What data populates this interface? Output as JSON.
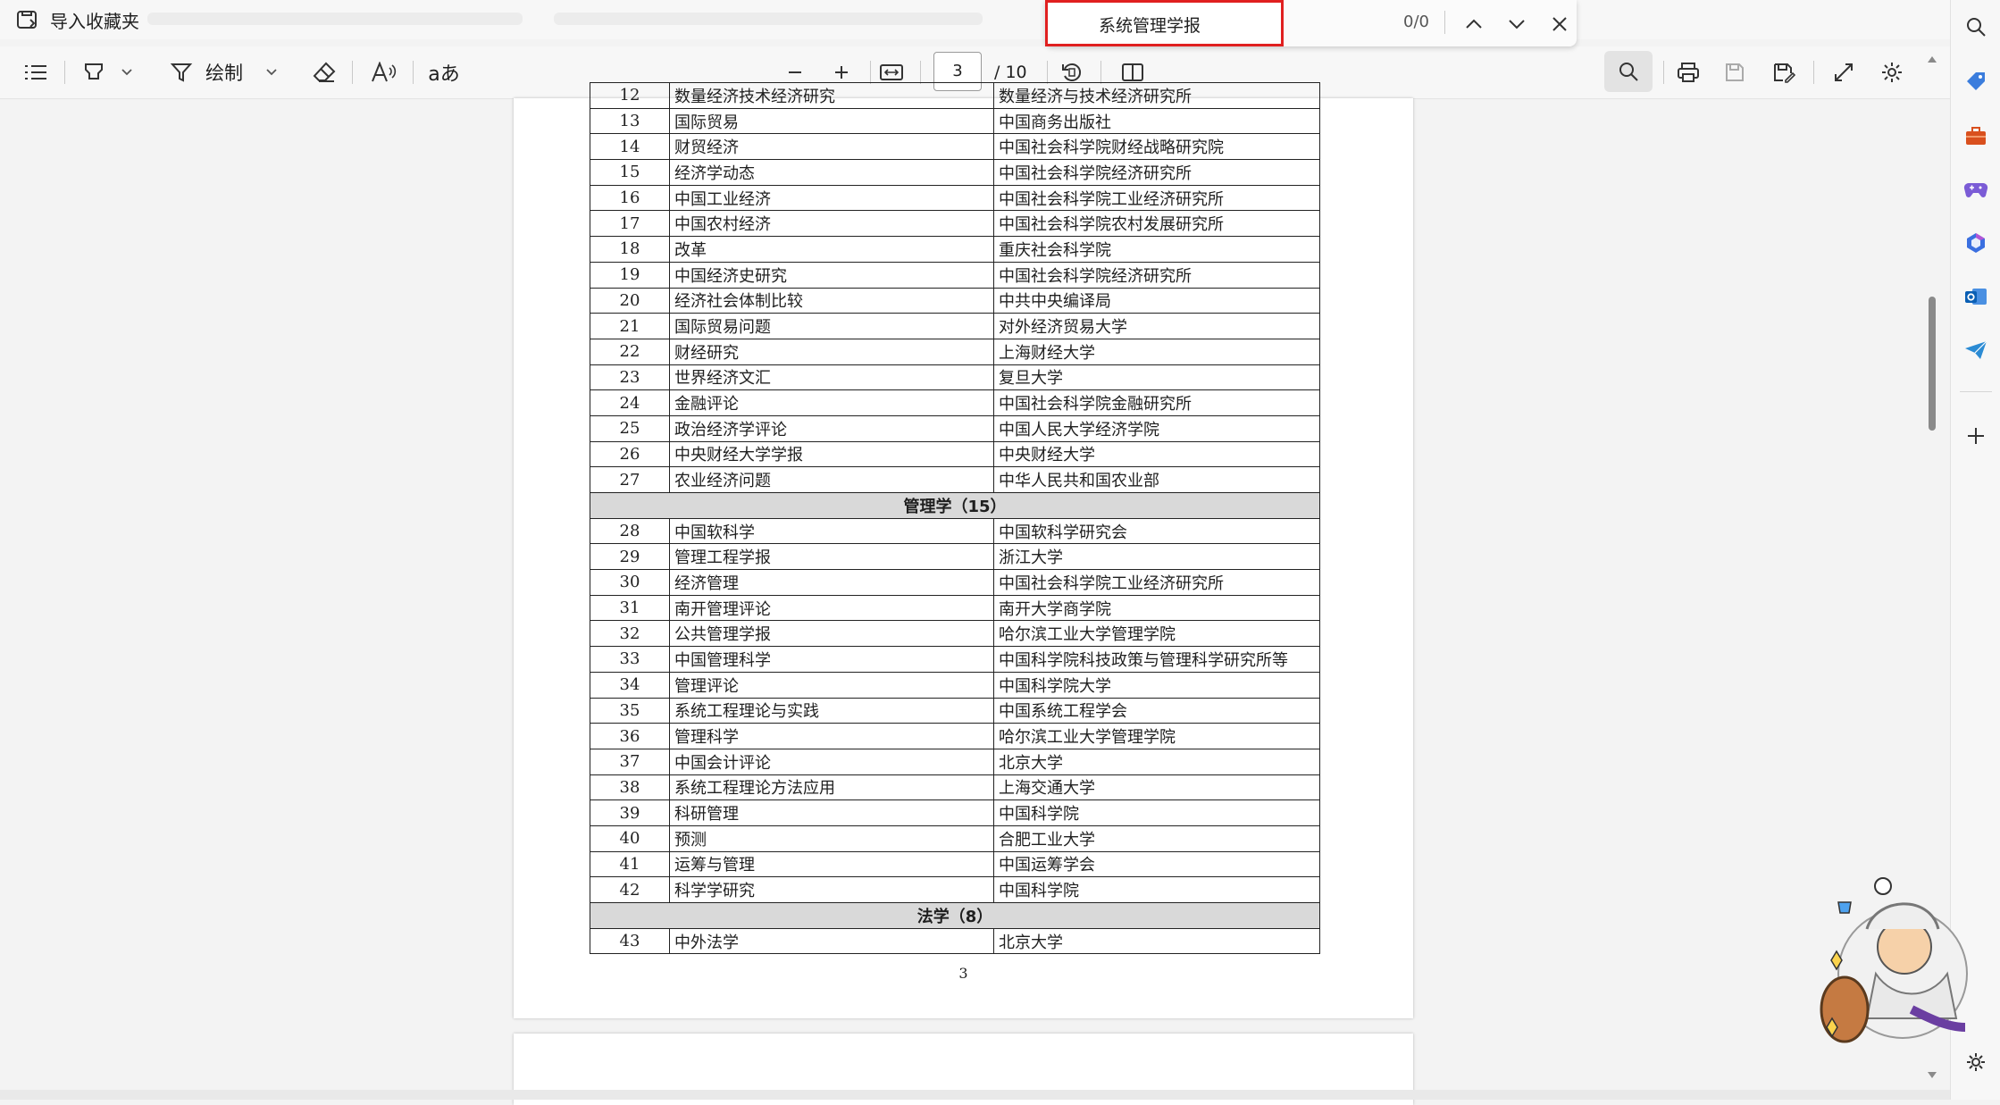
{
  "favorites_bar": {
    "import_label": "导入收藏夹"
  },
  "find_bar": {
    "query": "系统管理学报",
    "match_count": "0/0"
  },
  "toolbar": {
    "draw_label": "绘制",
    "current_page": "3",
    "total_pages": "/ 10"
  },
  "table": {
    "rows": [
      {
        "type": "row",
        "num": "12",
        "name": "数量经济技术经济研究",
        "publisher": "数量经济与技术经济研究所"
      },
      {
        "type": "row",
        "num": "13",
        "name": "国际贸易",
        "publisher": "中国商务出版社"
      },
      {
        "type": "row",
        "num": "14",
        "name": "财贸经济",
        "publisher": "中国社会科学院财经战略研究院"
      },
      {
        "type": "row",
        "num": "15",
        "name": "经济学动态",
        "publisher": "中国社会科学院经济研究所"
      },
      {
        "type": "row",
        "num": "16",
        "name": "中国工业经济",
        "publisher": "中国社会科学院工业经济研究所"
      },
      {
        "type": "row",
        "num": "17",
        "name": "中国农村经济",
        "publisher": "中国社会科学院农村发展研究所"
      },
      {
        "type": "row",
        "num": "18",
        "name": "改革",
        "publisher": "重庆社会科学院"
      },
      {
        "type": "row",
        "num": "19",
        "name": "中国经济史研究",
        "publisher": "中国社会科学院经济研究所"
      },
      {
        "type": "row",
        "num": "20",
        "name": "经济社会体制比较",
        "publisher": "中共中央编译局"
      },
      {
        "type": "row",
        "num": "21",
        "name": "国际贸易问题",
        "publisher": "对外经济贸易大学"
      },
      {
        "type": "row",
        "num": "22",
        "name": "财经研究",
        "publisher": "上海财经大学"
      },
      {
        "type": "row",
        "num": "23",
        "name": "世界经济文汇",
        "publisher": "复旦大学"
      },
      {
        "type": "row",
        "num": "24",
        "name": "金融评论",
        "publisher": "中国社会科学院金融研究所"
      },
      {
        "type": "row",
        "num": "25",
        "name": "政治经济学评论",
        "publisher": "中国人民大学经济学院"
      },
      {
        "type": "row",
        "num": "26",
        "name": "中央财经大学学报",
        "publisher": "中央财经大学"
      },
      {
        "type": "row",
        "num": "27",
        "name": "农业经济问题",
        "publisher": "中华人民共和国农业部"
      },
      {
        "type": "section",
        "title": "管理学（15）"
      },
      {
        "type": "row",
        "num": "28",
        "name": "中国软科学",
        "publisher": "中国软科学研究会"
      },
      {
        "type": "row",
        "num": "29",
        "name": "管理工程学报",
        "publisher": "浙江大学"
      },
      {
        "type": "row",
        "num": "30",
        "name": "经济管理",
        "publisher": "中国社会科学院工业经济研究所"
      },
      {
        "type": "row",
        "num": "31",
        "name": "南开管理评论",
        "publisher": "南开大学商学院"
      },
      {
        "type": "row",
        "num": "32",
        "name": "公共管理学报",
        "publisher": "哈尔滨工业大学管理学院"
      },
      {
        "type": "row",
        "num": "33",
        "name": "中国管理科学",
        "publisher": "中国科学院科技政策与管理科学研究所等"
      },
      {
        "type": "row",
        "num": "34",
        "name": "管理评论",
        "publisher": "中国科学院大学"
      },
      {
        "type": "row",
        "num": "35",
        "name": "系统工程理论与实践",
        "publisher": "中国系统工程学会"
      },
      {
        "type": "row",
        "num": "36",
        "name": "管理科学",
        "publisher": "哈尔滨工业大学管理学院"
      },
      {
        "type": "row",
        "num": "37",
        "name": "中国会计评论",
        "publisher": "北京大学"
      },
      {
        "type": "row",
        "num": "38",
        "name": "系统工程理论方法应用",
        "publisher": "上海交通大学"
      },
      {
        "type": "row",
        "num": "39",
        "name": "科研管理",
        "publisher": "中国科学院"
      },
      {
        "type": "row",
        "num": "40",
        "name": "预测",
        "publisher": "合肥工业大学"
      },
      {
        "type": "row",
        "num": "41",
        "name": "运筹与管理",
        "publisher": "中国运筹学会"
      },
      {
        "type": "row",
        "num": "42",
        "name": "科学学研究",
        "publisher": "中国科学院"
      },
      {
        "type": "section",
        "title": "法学（8）"
      },
      {
        "type": "row",
        "num": "43",
        "name": "中外法学",
        "publisher": "北京大学"
      }
    ]
  },
  "page_number": "3",
  "colors": {
    "find_border": "#e02020",
    "section_bg": "#d9d9d9"
  }
}
